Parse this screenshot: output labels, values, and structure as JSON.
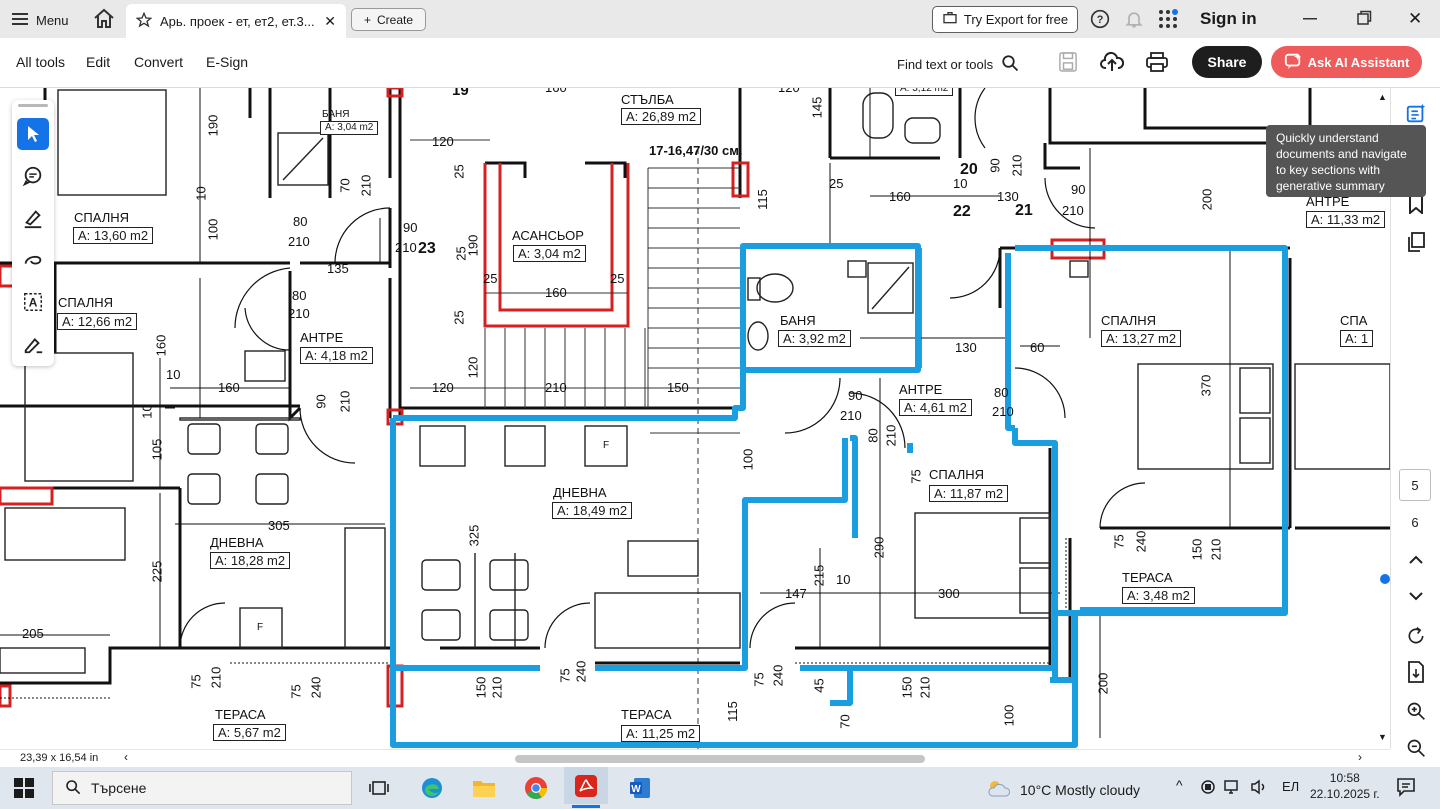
{
  "tabbar": {
    "menu_label": "Menu",
    "tab_title": "Арь. проек - ет, ет2, ет.3...",
    "create_label": "Create",
    "export_label": "Try Export for free",
    "signin_label": "Sign in"
  },
  "toolbar": {
    "items": [
      "All tools",
      "Edit",
      "Convert",
      "E-Sign"
    ],
    "find_label": "Find text or tools",
    "share_label": "Share",
    "ai_label": "Ask AI Assistant"
  },
  "tooltip": "Quickly understand documents and navigate to key sections with generative summary",
  "pages": {
    "current": "5",
    "next": "6"
  },
  "status": {
    "page_size": "23,39 x 16,54 in"
  },
  "plan": {
    "rooms": [
      {
        "name": "СПАЛНЯ",
        "area": "A: 13,60 m2"
      },
      {
        "name": "СПАЛНЯ",
        "area": "A: 12,66 m2"
      },
      {
        "name": "АНТРЕ",
        "area": "A: 4,18 m2"
      },
      {
        "name": "ДНЕВНА",
        "area": "A: 18,28 m2"
      },
      {
        "name": "ТЕРАСА",
        "area": "A: 5,67 m2"
      },
      {
        "name": "БАНЯ",
        "area": "A: 3,04 m2"
      },
      {
        "name": "АСАНСЬОР",
        "area": "A: 3,04 m2"
      },
      {
        "name": "СТЪЛБА",
        "area": "A: 26,89 m2"
      },
      {
        "name": "ДНЕВНА",
        "area": "A: 18,49 m2"
      },
      {
        "name": "ТЕРАСА",
        "area": "A: 11,25 m2"
      },
      {
        "name": "БАНЯ",
        "area": "A: 3,92 m2"
      },
      {
        "name": "АНТРЕ",
        "area": "A: 4,61 m2"
      },
      {
        "name": "СПАЛНЯ",
        "area": "A: 11,87 m2"
      },
      {
        "name": "СПАЛНЯ",
        "area": "A: 13,27 m2"
      },
      {
        "name": "ТЕРАСА",
        "area": "A: 3,48 m2"
      },
      {
        "name": "АНТРЕ",
        "area": "A: 11,33 m2"
      },
      {
        "name": "СПА",
        "area": "A: 1"
      }
    ],
    "top_area": "A: 3,12 m2",
    "stair_note": "17-16,47/30 см.",
    "unit_numbers": [
      "19",
      "20",
      "21",
      "22",
      "23"
    ],
    "dims": [
      "160",
      "145",
      "120",
      "190",
      "10",
      "100",
      "80",
      "210",
      "120",
      "25",
      "70",
      "210",
      "90",
      "210",
      "135",
      "80",
      "210",
      "160",
      "25",
      "190",
      "25",
      "160",
      "25",
      "25",
      "120",
      "120",
      "210",
      "150",
      "115",
      "25",
      "160",
      "10",
      "130",
      "90",
      "210",
      "90",
      "210",
      "200",
      "160",
      "10",
      "10",
      "105",
      "90",
      "210",
      "130",
      "60",
      "370",
      "225",
      "305",
      "325",
      "100",
      "290",
      "215",
      "10",
      "147",
      "300",
      "75",
      "240",
      "150",
      "210",
      "205",
      "75",
      "210",
      "75",
      "240",
      "115",
      "75",
      "240",
      "45",
      "70",
      "150",
      "210",
      "100",
      "200",
      "75",
      "240",
      "150",
      "210",
      "80",
      "210",
      "90",
      "210",
      "80",
      "210",
      "75",
      "F",
      "F"
    ]
  },
  "taskbar": {
    "search_placeholder": "Търсене",
    "weather": "10°C  Mostly cloudy",
    "lang": "EЛ",
    "time": "10:58",
    "date": "22.10.2025 г."
  },
  "colors": {
    "highlight": "#1a9ee0",
    "walls_red": "#d42020",
    "accent_blue": "#1473e6",
    "ai_button": "#ef5b5b"
  }
}
